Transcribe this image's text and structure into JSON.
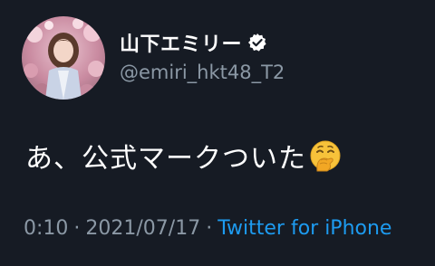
{
  "user": {
    "display_name": "山下エミリー",
    "handle": "@emiri_hkt48_T2",
    "verified": true
  },
  "tweet": {
    "text": "あ、公式マークついた",
    "emoji": "face-with-hand-over-mouth"
  },
  "meta": {
    "time": "0:10",
    "separator": "·",
    "date": "2021/07/17",
    "source": "Twitter for iPhone"
  },
  "colors": {
    "background": "#161b24",
    "primary_text": "#ffffff",
    "secondary_text": "#8b98a5",
    "link": "#1d9bf0"
  }
}
